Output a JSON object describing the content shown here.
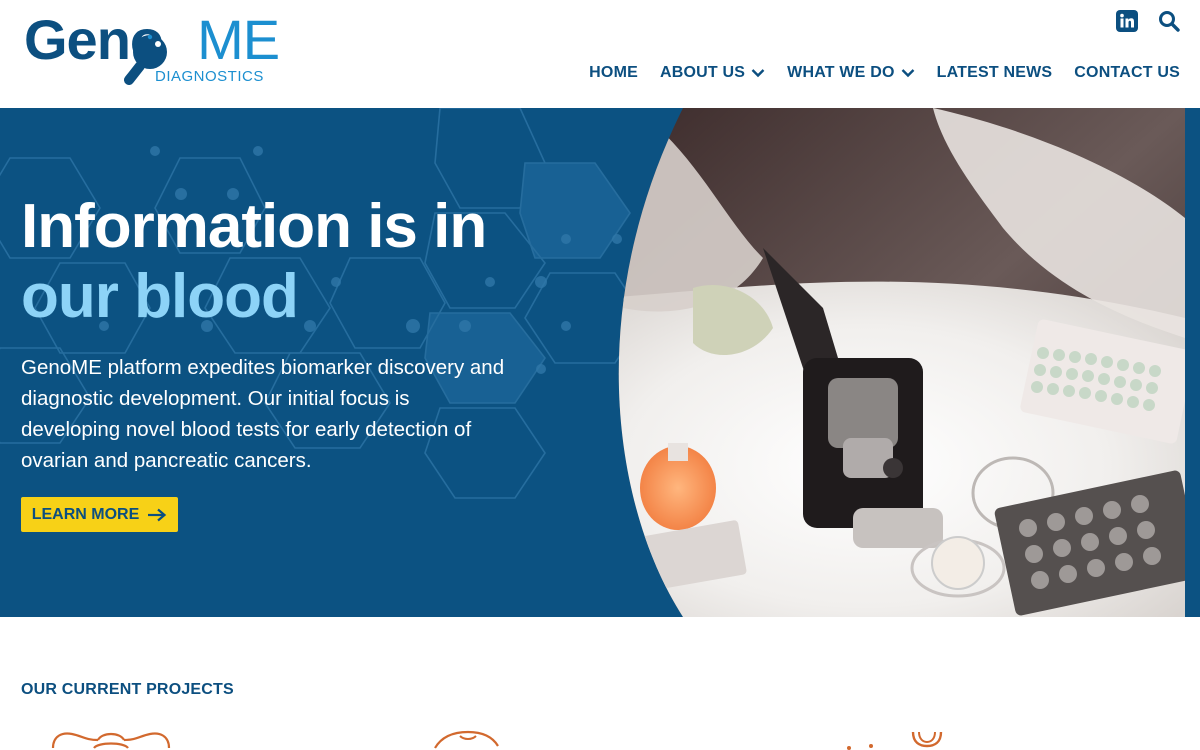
{
  "brand": {
    "name_part1": "Geno",
    "name_part2": "ME",
    "tagline": "DIAGNOSTICS",
    "colors": {
      "navy": "#0c4f80",
      "sky": "#1c8fd0",
      "hero_bg": "#0c5282",
      "accent_light": "#8dd3f7",
      "cta_yellow": "#f7d117",
      "project_orange": "#d2692e"
    }
  },
  "header": {
    "social": [
      {
        "icon": "linkedin-icon"
      },
      {
        "icon": "search-icon"
      }
    ],
    "nav": [
      {
        "label": "HOME",
        "dropdown": false
      },
      {
        "label": "ABOUT US",
        "dropdown": true
      },
      {
        "label": "WHAT WE DO",
        "dropdown": true
      },
      {
        "label": "LATEST NEWS",
        "dropdown": false
      },
      {
        "label": "CONTACT US",
        "dropdown": false
      }
    ]
  },
  "hero": {
    "title_line1": "Information is in",
    "title_line2": "our blood",
    "description": "GenoME platform expedites biomarker discovery and diagnostic development. Our initial focus is developing novel blood tests for early detection of ovarian and pancreatic cancers.",
    "cta_label": "LEARN MORE"
  },
  "projects": {
    "section_label": "OUR CURRENT PROJECTS",
    "items": [
      {
        "icon": "ovary-icon"
      },
      {
        "icon": "organ-icon"
      },
      {
        "icon": "pancreas-icon"
      }
    ]
  }
}
